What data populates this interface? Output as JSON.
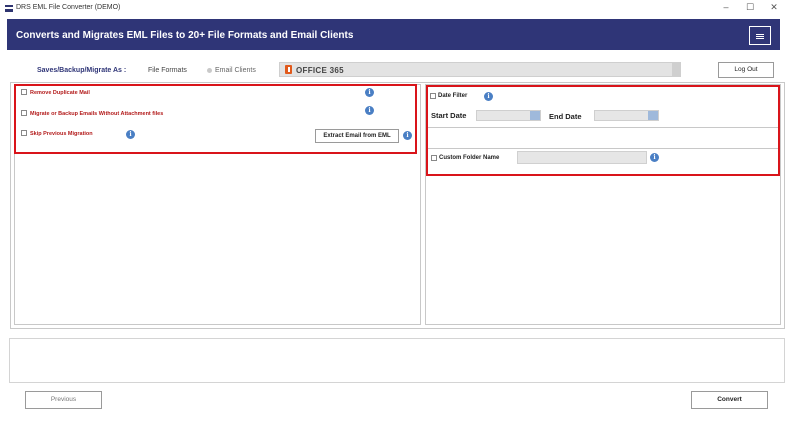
{
  "window": {
    "title": "DRS EML File Converter (DEMO)",
    "controls": {
      "minimize": "–",
      "maximize": "☐",
      "close": "✕"
    }
  },
  "banner": {
    "title": "Converts and Migrates EML Files to 20+ File Formats and Email Clients"
  },
  "saveas": {
    "label": "Saves/Backup/Migrate As :",
    "options": [
      {
        "label": "File Formats"
      },
      {
        "label": "Email Clients"
      }
    ],
    "selected_value": "OFFICE 365"
  },
  "logout_label": "Log Out",
  "options": {
    "remove_duplicate": "Remove Duplicate Mail",
    "without_attachment": "Migrate or Backup Emails Without Attachment files",
    "skip_previous": "Skip Previous Migration",
    "extract_button": "Extract Email from EML"
  },
  "filters": {
    "date_filter": "Date Filter",
    "start_date": "Start Date",
    "end_date": "End Date",
    "custom_folder": "Custom Folder Name"
  },
  "info_glyph": "i",
  "footer": {
    "previous_label": "Previous",
    "convert_label": "Convert"
  },
  "colors": {
    "banner": "#2f3577",
    "highlight_border": "#d9141a",
    "option_text": "#b31b1b",
    "info_icon": "#4a7fc4"
  }
}
